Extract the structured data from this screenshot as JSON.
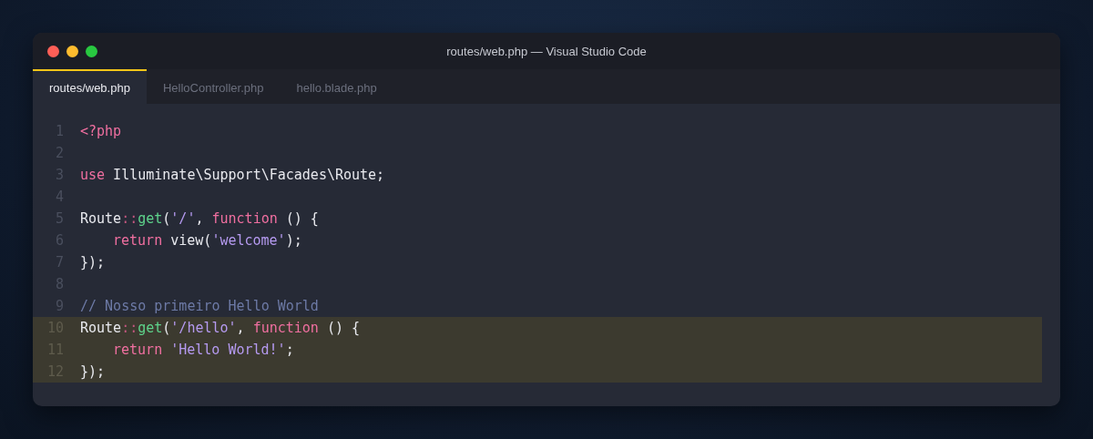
{
  "window": {
    "title": "routes/web.php — Visual Studio Code"
  },
  "tabs": [
    {
      "label": "routes/web.php",
      "selected": true
    },
    {
      "label": "HelloController.php",
      "selected": false
    },
    {
      "label": "hello.blade.php",
      "selected": false
    }
  ],
  "lines": [
    {
      "number": "1",
      "highlighted": false,
      "tokens": [
        {
          "kind": "keyword",
          "text": "<?php"
        }
      ]
    },
    {
      "number": "2",
      "highlighted": false
    },
    {
      "number": "3",
      "highlighted": false,
      "tokens": [
        {
          "kind": "keyword",
          "text": "use"
        },
        {
          "kind": "plain",
          "text": " Illuminate\\Support\\Facades\\Route;"
        }
      ]
    },
    {
      "number": "4",
      "highlighted": false
    },
    {
      "number": "5",
      "highlighted": false,
      "tokens": [
        {
          "kind": "plain",
          "text": "Route"
        },
        {
          "kind": "operator",
          "text": "::"
        },
        {
          "kind": "function",
          "text": "get"
        },
        {
          "kind": "plain",
          "text": "("
        },
        {
          "kind": "string",
          "text": "'/'"
        },
        {
          "kind": "plain",
          "text": ", "
        },
        {
          "kind": "keyword",
          "text": "function"
        },
        {
          "kind": "plain",
          "text": " () {"
        }
      ]
    },
    {
      "number": "6",
      "highlighted": false,
      "indented": true,
      "tokens": [
        {
          "kind": "keyword",
          "text": "return"
        },
        {
          "kind": "plain",
          "text": " view("
        },
        {
          "kind": "string",
          "text": "'welcome'"
        },
        {
          "kind": "plain",
          "text": ");"
        }
      ]
    },
    {
      "number": "7",
      "highlighted": false,
      "tokens": [
        {
          "kind": "plain",
          "text": "});"
        }
      ]
    },
    {
      "number": "8",
      "highlighted": false
    },
    {
      "number": "9",
      "highlighted": false,
      "tokens": [
        {
          "kind": "comment",
          "text": "// Nosso primeiro Hello World"
        }
      ]
    },
    {
      "number": "10",
      "highlighted": true,
      "tokens": [
        {
          "kind": "plain",
          "text": "Route"
        },
        {
          "kind": "operator",
          "text": "::"
        },
        {
          "kind": "function",
          "text": "get"
        },
        {
          "kind": "plain",
          "text": "("
        },
        {
          "kind": "string",
          "text": "'/hello'"
        },
        {
          "kind": "plain",
          "text": ", "
        },
        {
          "kind": "keyword",
          "text": "function"
        },
        {
          "kind": "plain",
          "text": " () {"
        }
      ]
    },
    {
      "number": "11",
      "highlighted": true,
      "indented": true,
      "tokens": [
        {
          "kind": "keyword",
          "text": "return"
        },
        {
          "kind": "string",
          "text": " 'Hello World!'"
        },
        {
          "kind": "plain",
          "text": ";"
        }
      ]
    },
    {
      "number": "12",
      "highlighted": true,
      "tokens": [
        {
          "kind": "plain",
          "text": "});"
        }
      ]
    }
  ]
}
